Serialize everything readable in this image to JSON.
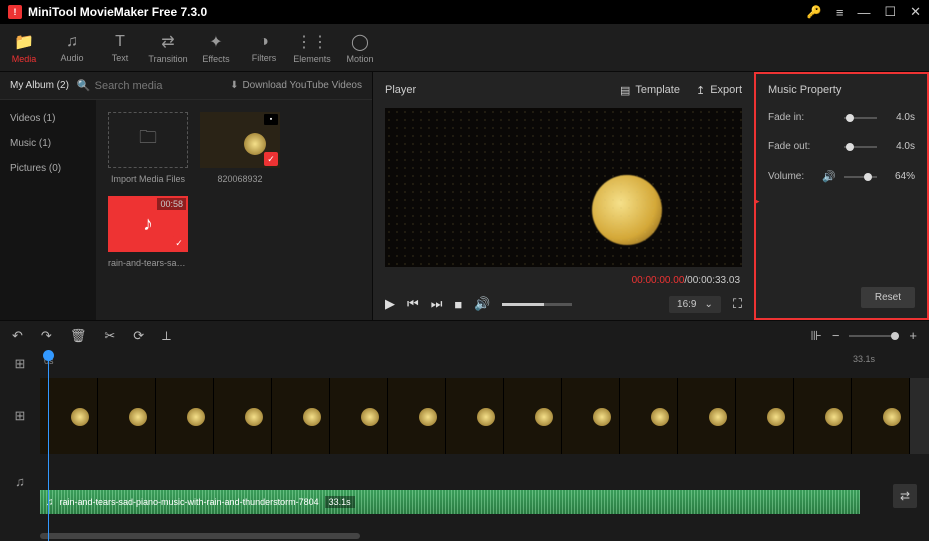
{
  "app": {
    "title": "MiniTool MovieMaker Free 7.3.0"
  },
  "toolbar": [
    {
      "label": "Media",
      "icon": "folder"
    },
    {
      "label": "Audio",
      "icon": "note"
    },
    {
      "label": "Text",
      "icon": "text"
    },
    {
      "label": "Transition",
      "icon": "trans"
    },
    {
      "label": "Effects",
      "icon": "fx"
    },
    {
      "label": "Filters",
      "icon": "filter"
    },
    {
      "label": "Elements",
      "icon": "elem"
    },
    {
      "label": "Motion",
      "icon": "motion"
    }
  ],
  "search": {
    "album": "My Album (2)",
    "placeholder": "Search media",
    "download": "Download YouTube Videos"
  },
  "categories": [
    {
      "label": "Videos (1)"
    },
    {
      "label": "Music (1)"
    },
    {
      "label": "Pictures (0)"
    }
  ],
  "media": {
    "import": "Import Media Files",
    "video": {
      "name": "820068932"
    },
    "audio": {
      "name": "rain-and-tears-sad-...",
      "duration": "00:58"
    }
  },
  "player": {
    "title": "Player",
    "template": "Template",
    "export": "Export",
    "cur": "00:00:00.00",
    "sep": " / ",
    "tot": "00:00:33.03",
    "aspect": "16:9"
  },
  "props": {
    "title": "Music Property",
    "fadein": {
      "label": "Fade in:",
      "value": "4.0s"
    },
    "fadeout": {
      "label": "Fade out:",
      "value": "4.0s"
    },
    "volume": {
      "label": "Volume:",
      "value": "64%"
    },
    "reset": "Reset"
  },
  "timeline": {
    "ruler0": "0s",
    "total": "33.1s",
    "audio_name": "rain-and-tears-sad-piano-music-with-rain-and-thunderstorm-7804",
    "audio_dur": "33.1s"
  }
}
